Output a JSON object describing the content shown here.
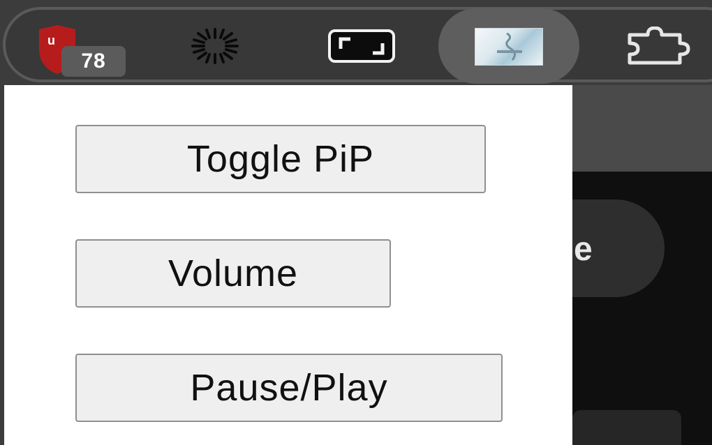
{
  "toolbar": {
    "extensions": [
      {
        "name": "ublock",
        "icon": "ublock-shield-icon",
        "badge": "78",
        "color": "#b71c1c"
      },
      {
        "name": "loading",
        "icon": "spinner-icon"
      },
      {
        "name": "pip",
        "icon": "fullscreen-icon"
      },
      {
        "name": "video-thumbnail",
        "icon": "thumbnail-icon",
        "active": true
      },
      {
        "name": "extensions",
        "icon": "puzzle-icon"
      }
    ],
    "badge_text": "78"
  },
  "popup": {
    "buttons": {
      "toggle_pip": "Toggle PiP",
      "volume": "Volume",
      "pause_play": "Pause/Play"
    }
  },
  "page": {
    "visible_letter": "e"
  },
  "colors": {
    "toolbar_bg": "#3c3c3c",
    "popup_bg": "#ffffff",
    "button_bg": "#efefef",
    "button_border": "#8f8f8f",
    "ublock_red": "#b71c1c"
  }
}
